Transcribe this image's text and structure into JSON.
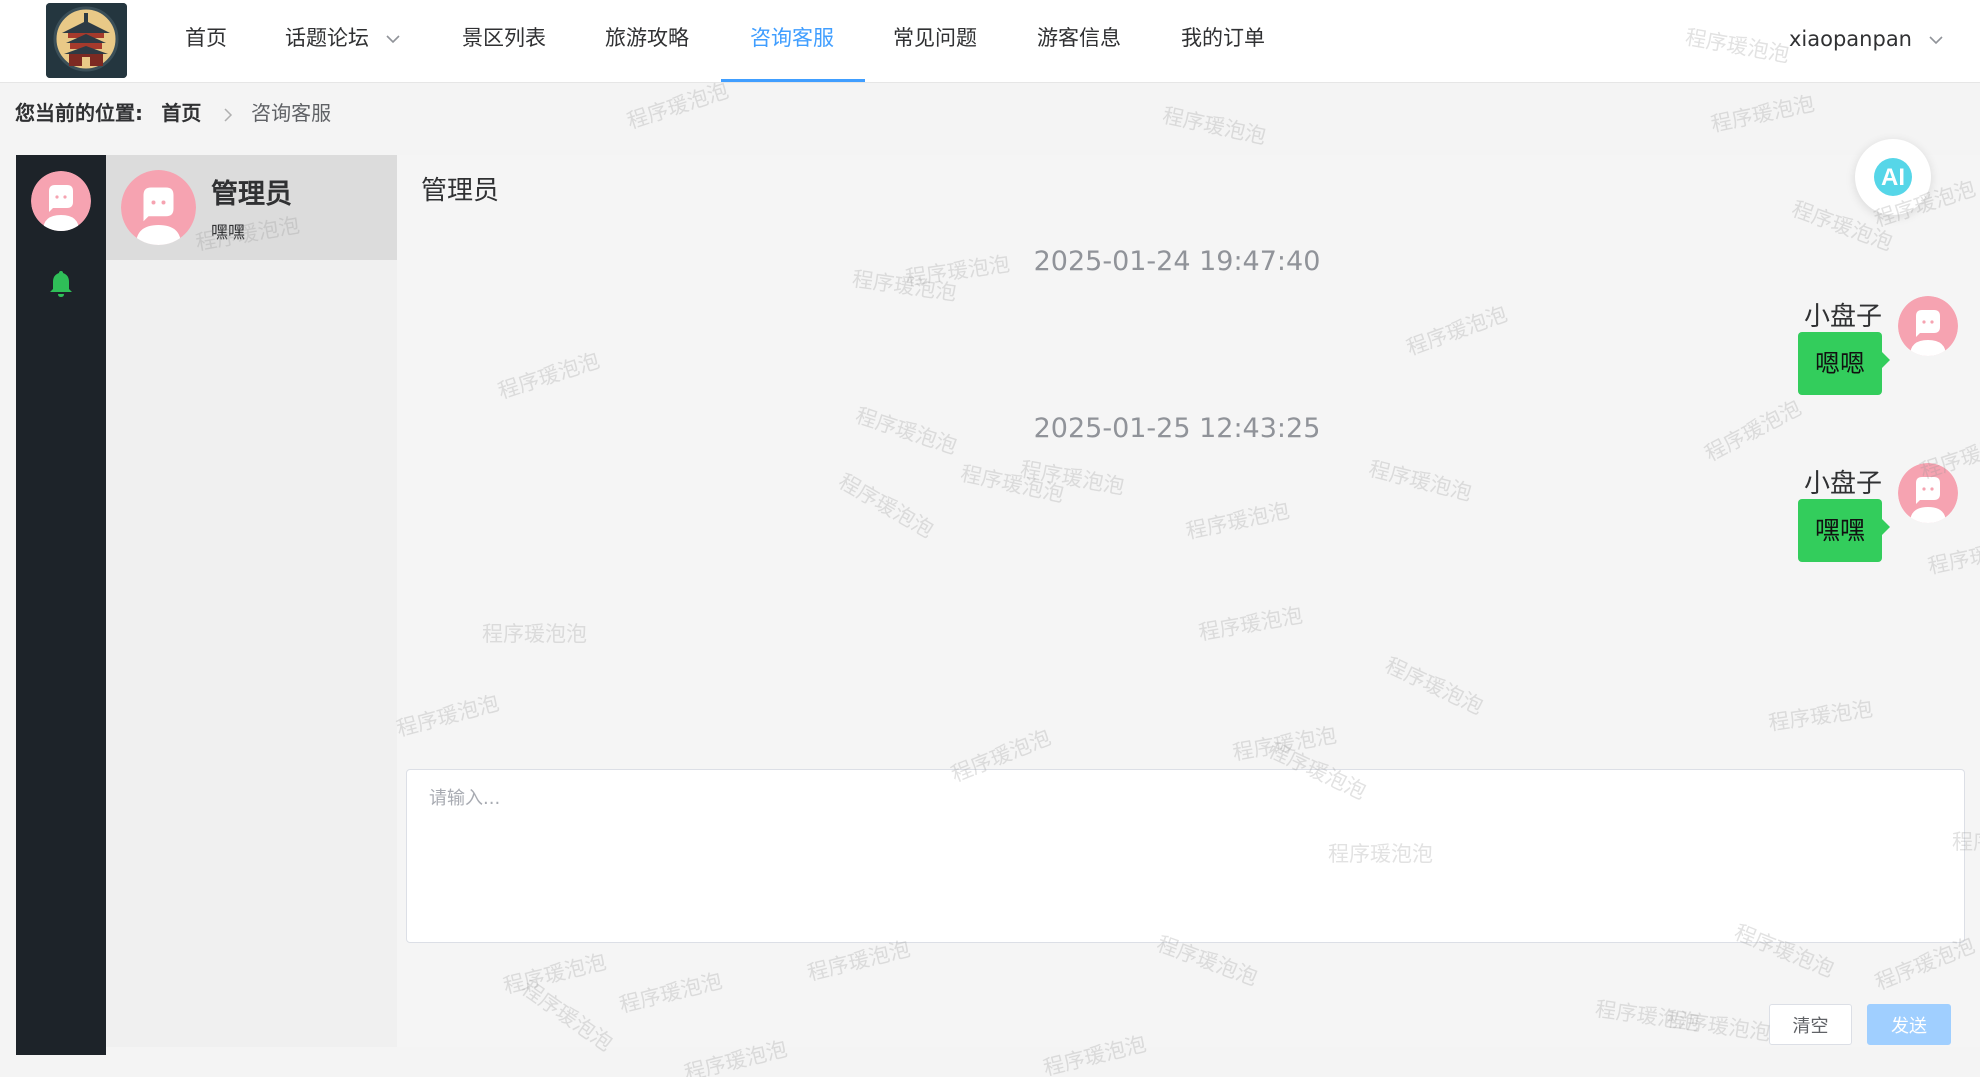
{
  "nav": {
    "items": [
      {
        "label": "首页"
      },
      {
        "label": "话题论坛"
      },
      {
        "label": "景区列表"
      },
      {
        "label": "旅游攻略"
      },
      {
        "label": "咨询客服"
      },
      {
        "label": "常见问题"
      },
      {
        "label": "游客信息"
      },
      {
        "label": "我的订单"
      }
    ],
    "active_index": 4,
    "username": "xiaopanpan"
  },
  "breadcrumb": {
    "label": "您当前的位置:",
    "home": "首页",
    "current": "咨询客服"
  },
  "contacts": [
    {
      "name": "管理员",
      "preview": "嘿嘿"
    }
  ],
  "chat": {
    "title": "管理员",
    "messages": [
      {
        "time": "2025-01-24 19:47:40",
        "sender": "小盘子",
        "text": "嗯嗯"
      },
      {
        "time": "2025-01-25 12:43:25",
        "sender": "小盘子",
        "text": "嘿嘿"
      }
    ],
    "ai_label": "AI"
  },
  "composer": {
    "placeholder": "请输入...",
    "value": "",
    "clear_label": "清空",
    "send_label": "发送"
  },
  "watermark": "程序瑗泡泡",
  "colors": {
    "accent": "#409eff",
    "bubble": "#33cd5c",
    "rail": "#1d2329",
    "send_disabled": "#a0cfff",
    "bell": "#2fbf58"
  }
}
